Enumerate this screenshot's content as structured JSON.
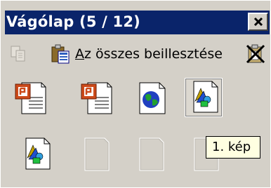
{
  "titlebar": {
    "title": "Vágólap (5 / 12)"
  },
  "toolbar": {
    "copy_icon": "copy-icon",
    "paste_all_icon": "paste-all-icon",
    "paste_all_mnemonic": "A",
    "paste_all_rest": "z összes beillesztése",
    "clear_all_icon": "clear-all-icon"
  },
  "items": [
    {
      "kind": "powerpoint-document",
      "icon": "powerpoint-document-icon"
    },
    {
      "kind": "powerpoint-document",
      "icon": "powerpoint-document-icon"
    },
    {
      "kind": "web-document",
      "icon": "globe-document-icon"
    },
    {
      "kind": "image",
      "icon": "picture-document-icon",
      "selected": true
    },
    {
      "kind": "image",
      "icon": "picture-document-icon"
    },
    {
      "kind": "empty"
    },
    {
      "kind": "empty"
    },
    {
      "kind": "empty"
    }
  ],
  "tooltip": {
    "text": "1. kép"
  },
  "colors": {
    "titlebar": "#0a246a",
    "face": "#d4d0c8",
    "tooltip_bg": "#ffffe1",
    "ppt_orange": "#cc4a1a"
  }
}
